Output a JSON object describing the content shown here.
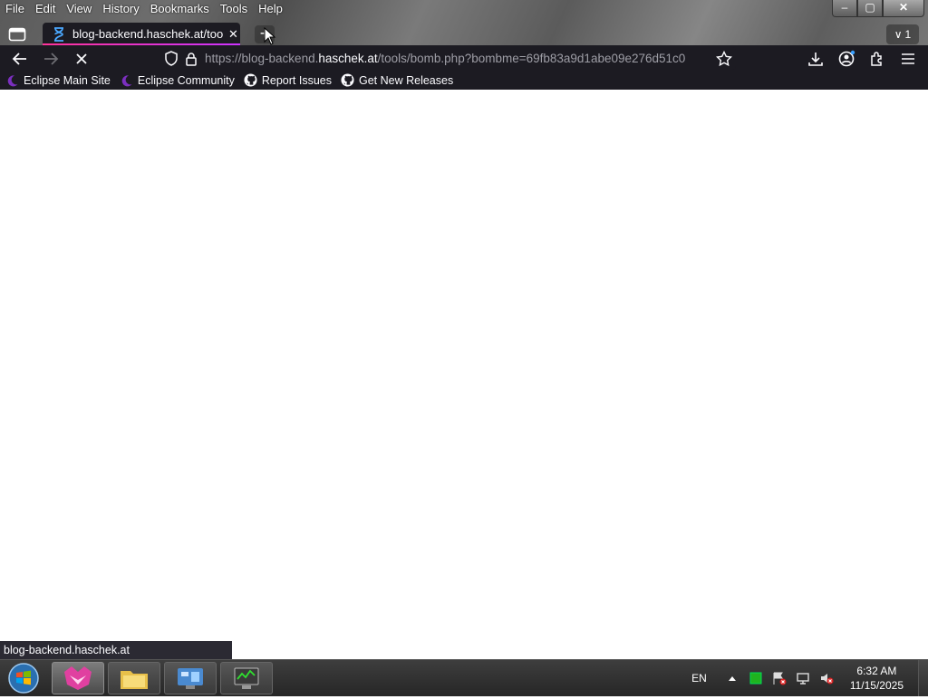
{
  "menubar": {
    "items": [
      "File",
      "Edit",
      "View",
      "History",
      "Bookmarks",
      "Tools",
      "Help"
    ]
  },
  "window_controls": {
    "minimize": "–",
    "maximize": "▢",
    "close": "✕"
  },
  "tab": {
    "title": "blog-backend.haschek.at/tools/bomb.php",
    "close": "✕"
  },
  "new_tab": "+",
  "tab_overflow": {
    "chevron": "∨",
    "count": "1"
  },
  "urlbar": {
    "url_prefix": "https://blog-backend.",
    "url_host": "haschek.at",
    "url_suffix": "/tools/bomb.php?bombme=69fb83a9d1abe09e276d51c0"
  },
  "bookmarks": [
    {
      "label": "Eclipse Main Site",
      "icon": "eclipse-icon"
    },
    {
      "label": "Eclipse Community",
      "icon": "eclipse-icon"
    },
    {
      "label": "Report Issues",
      "icon": "github-icon"
    },
    {
      "label": "Get New Releases",
      "icon": "github-icon"
    }
  ],
  "status_link": "blog-backend.haschek.at",
  "taskbar": {
    "language": "EN",
    "time": "6:32 AM",
    "date": "11/15/2025"
  },
  "colors": {
    "toolbar_bg": "#1c1b22",
    "tab_accent": "#ff3399",
    "taskbar_bg": "#2e2e2e"
  }
}
